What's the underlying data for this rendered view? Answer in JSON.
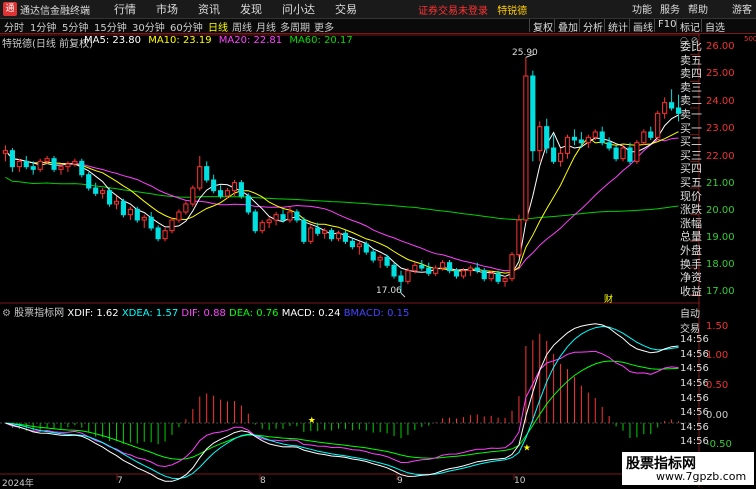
{
  "app": {
    "title": "通达信金融终端",
    "logo": "通"
  },
  "menu": [
    "行情",
    "市场",
    "资讯",
    "发现",
    "问小达",
    "交易"
  ],
  "notice": "证券交易未登录",
  "notice_stock": "特锐德",
  "window_buttons": [
    "功能",
    "服务",
    "帮助",
    "游客"
  ],
  "periods": [
    "分时",
    "1分钟",
    "5分钟",
    "15分钟",
    "30分钟",
    "60分钟",
    "日线",
    "周线",
    "月线",
    "多周期",
    "更多"
  ],
  "active_period": "日线",
  "right_toolbar": [
    "复权",
    "叠加",
    "分析",
    "统计",
    "画线",
    "F10",
    "标记",
    "自选"
  ],
  "stock_title": "特锐德(日线 前复权)",
  "ma": {
    "ma5": {
      "label": "MA5: 23.80",
      "color": "#ffffff"
    },
    "ma10": {
      "label": "MA10: 23.19",
      "color": "#ffff00"
    },
    "ma20": {
      "label": "MA20: 22.81",
      "color": "#ff40ff"
    },
    "ma60": {
      "label": "MA60: 20.17",
      "color": "#00d000"
    }
  },
  "price_axis": [
    "26.00",
    "25.00",
    "24.00",
    "23.00",
    "22.00",
    "21.00",
    "20.00",
    "19.00",
    "18.00",
    "17.00"
  ],
  "annotations": {
    "high": "25.90",
    "low": "17.06",
    "cai": "财"
  },
  "indicator_name": "股票指标网",
  "indicator_legend": {
    "xdif": {
      "label": "XDIF: 1.62",
      "color": "#ffffff"
    },
    "xdea": {
      "label": "XDEA: 1.57",
      "color": "#00ffff"
    },
    "dif": {
      "label": "DIF: 0.88",
      "color": "#ff40ff"
    },
    "dea": {
      "label": "DEA: 0.76",
      "color": "#00ff00"
    },
    "macd": {
      "label": "MACD: 0.24",
      "color": "#ffffff"
    },
    "bmacd": {
      "label": "BMACD: 0.15",
      "color": "#4444ff"
    }
  },
  "indicator_axis": [
    "1.50",
    "1.00",
    "0.50",
    "0.00",
    "-0.50"
  ],
  "date_axis": [
    "2024年",
    "7",
    "8",
    "9",
    "10",
    "11"
  ],
  "side_panel": [
    "委比",
    "卖五",
    "卖四",
    "卖三",
    "卖二",
    "卖一",
    "买一",
    "买二",
    "买三",
    "买四",
    "买五",
    "现价",
    "涨跌",
    "涨幅",
    "总量",
    "外盘",
    "换手",
    "净资",
    "收益"
  ],
  "side_panel2": [
    "自动",
    "交易",
    "14:56",
    "14:56",
    "14:56",
    "14:56",
    "14:56",
    "14:56",
    "14:56",
    "14:56"
  ],
  "axis_unit": "500",
  "watermark": {
    "line1": "股票指标网",
    "line2": "www.7gpzb.com"
  },
  "chart_data": {
    "type": "candlestick",
    "ylim": [
      16.8,
      26.4
    ],
    "candles": [
      [
        22.3,
        22.6,
        22.0,
        22.4
      ],
      [
        22.4,
        22.5,
        21.6,
        21.8
      ],
      [
        21.8,
        22.1,
        21.6,
        22.0
      ],
      [
        22.0,
        22.2,
        21.7,
        21.8
      ],
      [
        21.8,
        22.0,
        21.5,
        21.7
      ],
      [
        21.7,
        22.1,
        21.6,
        22.0
      ],
      [
        22.0,
        22.2,
        21.9,
        22.1
      ],
      [
        22.1,
        22.2,
        21.6,
        21.7
      ],
      [
        21.7,
        21.9,
        21.5,
        21.8
      ],
      [
        21.8,
        22.0,
        21.6,
        21.9
      ],
      [
        21.9,
        22.1,
        21.8,
        22.0
      ],
      [
        22.0,
        22.1,
        21.4,
        21.5
      ],
      [
        21.5,
        21.6,
        20.9,
        21.0
      ],
      [
        21.0,
        21.2,
        20.7,
        20.8
      ],
      [
        20.8,
        21.0,
        20.6,
        20.9
      ],
      [
        20.9,
        21.0,
        20.3,
        20.4
      ],
      [
        20.4,
        20.7,
        20.2,
        20.5
      ],
      [
        20.5,
        20.6,
        19.9,
        20.0
      ],
      [
        20.0,
        20.3,
        19.8,
        20.2
      ],
      [
        20.2,
        20.3,
        19.7,
        19.8
      ],
      [
        19.8,
        20.0,
        19.5,
        19.9
      ],
      [
        19.9,
        20.1,
        19.4,
        19.5
      ],
      [
        19.5,
        19.6,
        19.0,
        19.1
      ],
      [
        19.1,
        19.5,
        19.0,
        19.4
      ],
      [
        19.4,
        19.9,
        19.3,
        19.8
      ],
      [
        19.8,
        20.2,
        19.7,
        20.1
      ],
      [
        20.1,
        20.5,
        20.0,
        20.4
      ],
      [
        20.4,
        21.1,
        20.3,
        21.0
      ],
      [
        21.0,
        22.2,
        20.9,
        21.8
      ],
      [
        21.8,
        22.0,
        21.2,
        21.3
      ],
      [
        21.3,
        21.5,
        20.8,
        20.9
      ],
      [
        20.9,
        21.1,
        20.6,
        20.7
      ],
      [
        20.7,
        21.0,
        20.6,
        20.9
      ],
      [
        20.9,
        21.3,
        20.7,
        21.2
      ],
      [
        21.2,
        21.3,
        20.6,
        20.7
      ],
      [
        20.7,
        20.8,
        20.0,
        20.1
      ],
      [
        20.1,
        20.2,
        19.3,
        19.4
      ],
      [
        19.4,
        19.8,
        19.3,
        19.7
      ],
      [
        19.7,
        19.9,
        19.5,
        19.8
      ],
      [
        19.8,
        20.1,
        19.6,
        20.0
      ],
      [
        20.0,
        20.2,
        19.7,
        19.8
      ],
      [
        19.8,
        20.3,
        19.7,
        20.1
      ],
      [
        20.1,
        20.2,
        19.7,
        19.8
      ],
      [
        19.8,
        19.9,
        18.9,
        19.0
      ],
      [
        19.0,
        19.6,
        18.9,
        19.5
      ],
      [
        19.5,
        19.7,
        19.2,
        19.3
      ],
      [
        19.3,
        19.5,
        19.1,
        19.4
      ],
      [
        19.4,
        19.5,
        19.0,
        19.1
      ],
      [
        19.1,
        19.4,
        19.0,
        19.3
      ],
      [
        19.3,
        19.4,
        18.9,
        19.0
      ],
      [
        19.0,
        19.1,
        18.7,
        18.8
      ],
      [
        18.8,
        19.0,
        18.5,
        18.9
      ],
      [
        18.9,
        19.0,
        18.5,
        18.6
      ],
      [
        18.6,
        18.7,
        18.2,
        18.3
      ],
      [
        18.3,
        18.5,
        18.0,
        18.4
      ],
      [
        18.4,
        18.5,
        18.0,
        18.1
      ],
      [
        18.1,
        18.2,
        17.6,
        17.7
      ],
      [
        17.7,
        17.9,
        17.06,
        17.5
      ],
      [
        17.5,
        18.0,
        17.4,
        17.9
      ],
      [
        17.9,
        18.2,
        17.8,
        18.1
      ],
      [
        18.1,
        18.3,
        17.9,
        18.0
      ],
      [
        18.0,
        18.2,
        17.7,
        17.8
      ],
      [
        17.8,
        18.1,
        17.7,
        18.0
      ],
      [
        18.0,
        18.3,
        17.9,
        18.2
      ],
      [
        18.2,
        18.3,
        17.8,
        17.9
      ],
      [
        17.9,
        18.0,
        17.6,
        17.7
      ],
      [
        17.7,
        18.0,
        17.6,
        17.9
      ],
      [
        17.9,
        18.1,
        17.7,
        18.0
      ],
      [
        18.0,
        18.2,
        17.8,
        17.9
      ],
      [
        17.9,
        18.0,
        17.5,
        17.6
      ],
      [
        17.6,
        17.9,
        17.5,
        17.8
      ],
      [
        17.8,
        17.9,
        17.4,
        17.5
      ],
      [
        17.5,
        17.7,
        17.3,
        17.6
      ],
      [
        17.6,
        18.6,
        17.5,
        18.5
      ],
      [
        18.5,
        20.0,
        18.4,
        19.8
      ],
      [
        19.8,
        25.9,
        19.7,
        25.2
      ],
      [
        25.2,
        25.4,
        22.0,
        22.4
      ],
      [
        22.4,
        23.5,
        22.0,
        23.3
      ],
      [
        23.3,
        23.6,
        22.3,
        22.5
      ],
      [
        22.5,
        23.0,
        21.9,
        22.0
      ],
      [
        22.0,
        22.5,
        21.8,
        22.3
      ],
      [
        22.3,
        23.0,
        22.1,
        22.9
      ],
      [
        22.9,
        23.2,
        22.6,
        22.8
      ],
      [
        22.8,
        23.1,
        22.5,
        22.7
      ],
      [
        22.7,
        23.0,
        22.5,
        22.9
      ],
      [
        22.9,
        23.2,
        22.8,
        23.1
      ],
      [
        23.1,
        23.3,
        22.6,
        22.7
      ],
      [
        22.7,
        22.9,
        22.4,
        22.5
      ],
      [
        22.5,
        22.6,
        22.0,
        22.1
      ],
      [
        22.1,
        22.6,
        22.0,
        22.5
      ],
      [
        22.5,
        22.7,
        21.9,
        22.0
      ],
      [
        22.0,
        22.8,
        21.9,
        22.7
      ],
      [
        22.7,
        23.2,
        22.6,
        23.1
      ],
      [
        23.1,
        23.3,
        22.8,
        22.9
      ],
      [
        22.9,
        23.9,
        22.8,
        23.8
      ],
      [
        23.8,
        24.4,
        23.6,
        24.2
      ],
      [
        24.2,
        24.7,
        23.9,
        24.0
      ],
      [
        24.0,
        24.5,
        23.5,
        23.8
      ]
    ],
    "macd_ylim": [
      -0.8,
      1.75
    ]
  }
}
